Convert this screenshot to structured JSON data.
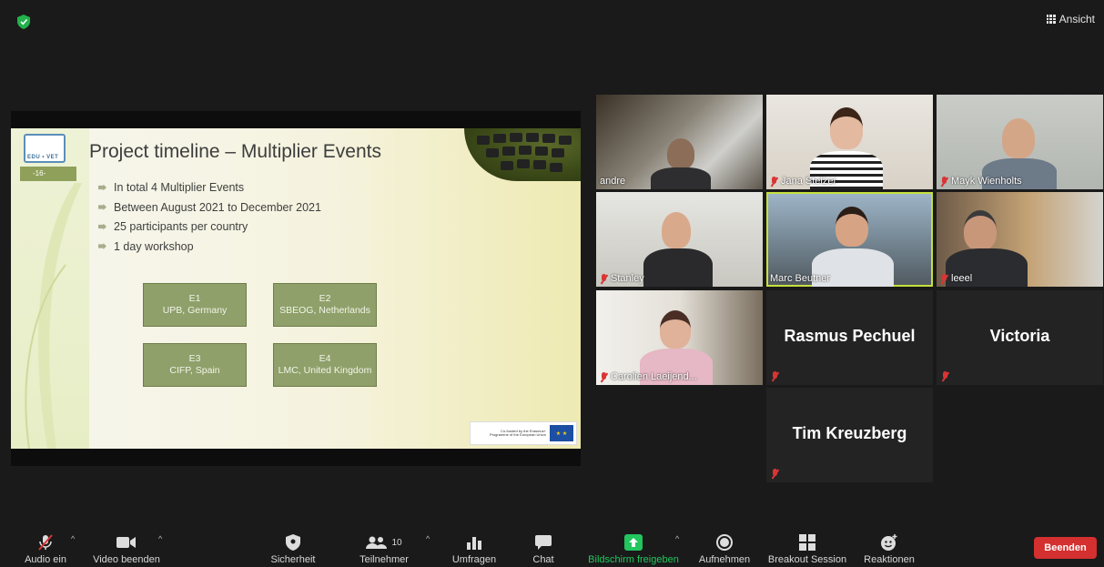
{
  "top": {
    "view_label": "Ansicht"
  },
  "slide": {
    "logo_text": "EDU • VET",
    "page_tag": "-16-",
    "title": "Project timeline – Multiplier Events",
    "bullets": [
      "In total 4 Multiplier Events",
      "Between August 2021 to December 2021",
      "25 participants per country",
      "1 day workshop"
    ],
    "events": [
      {
        "code": "E1",
        "text": "UPB, Germany"
      },
      {
        "code": "E2",
        "text": "SBEOG, Netherlands"
      },
      {
        "code": "E3",
        "text": "CIFP, Spain"
      },
      {
        "code": "E4",
        "text": "LMC, United Kingdom"
      }
    ],
    "eu_text": "Co-funded by the Erasmus+ Programme of the European Union"
  },
  "participants": [
    {
      "name": "andre",
      "muted": false
    },
    {
      "name": "Jana Stelzer",
      "muted": true
    },
    {
      "name": "Mayk Wienholts",
      "muted": true
    },
    {
      "name": "Stanley",
      "muted": true
    },
    {
      "name": "Marc Beutner",
      "muted": false,
      "active": true
    },
    {
      "name": "leeel",
      "muted": true
    },
    {
      "name": "Carolien Laeijend...",
      "muted": true
    },
    {
      "name": "Rasmus Pechuel",
      "muted": true
    },
    {
      "name": "Victoria",
      "muted": true
    },
    {
      "name": "Tim Kreuzberg",
      "muted": true
    }
  ],
  "toolbar": {
    "audio": "Audio ein",
    "video": "Video beenden",
    "security": "Sicherheit",
    "participants": "Teilnehmer",
    "participant_count": "10",
    "polls": "Umfragen",
    "chat": "Chat",
    "share": "Bildschirm freigeben",
    "record": "Aufnehmen",
    "breakout": "Breakout Session",
    "reactions": "Reaktionen",
    "end": "Beenden"
  },
  "colors": {
    "share_green": "#22c55e",
    "end_red": "#d3302f",
    "active_outline": "#c7e03c",
    "mute_red": "#d93535"
  }
}
